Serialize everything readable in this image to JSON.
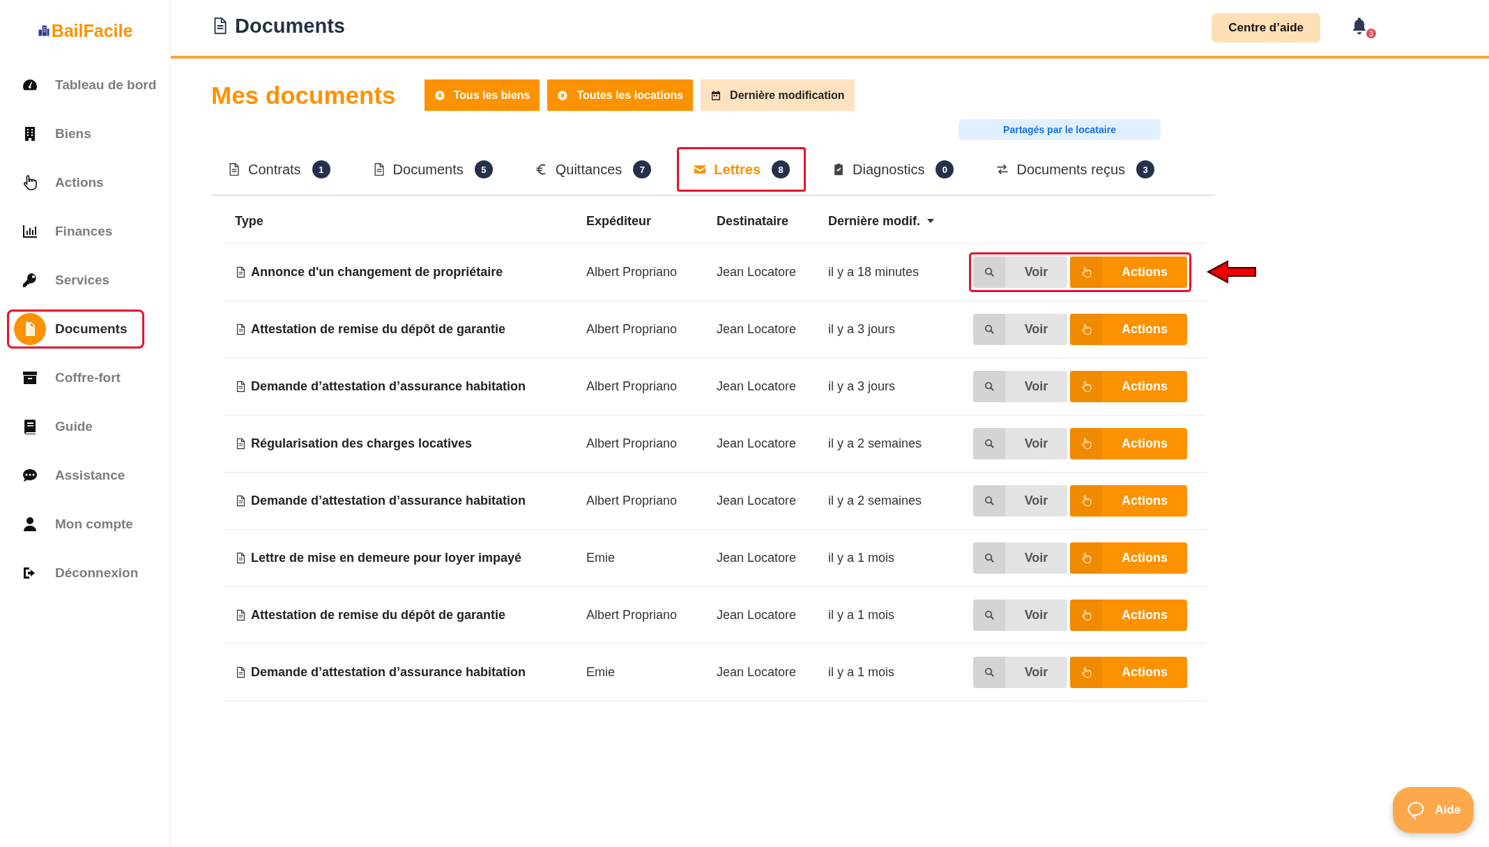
{
  "brand": {
    "name": "BailFacile"
  },
  "sidebar": {
    "items": [
      {
        "label": "Tableau de bord",
        "selected": false,
        "highlighted": false
      },
      {
        "label": "Biens",
        "selected": false,
        "highlighted": false
      },
      {
        "label": "Actions",
        "selected": false,
        "highlighted": false
      },
      {
        "label": "Finances",
        "selected": false,
        "highlighted": false
      },
      {
        "label": "Services",
        "selected": false,
        "highlighted": false
      },
      {
        "label": "Documents",
        "selected": true,
        "highlighted": true
      },
      {
        "label": "Coffre-fort",
        "selected": false,
        "highlighted": false
      },
      {
        "label": "Guide",
        "selected": false,
        "highlighted": false
      },
      {
        "label": "Assistance",
        "selected": false,
        "highlighted": false
      },
      {
        "label": "Mon compte",
        "selected": false,
        "highlighted": false
      },
      {
        "label": "Déconnexion",
        "selected": false,
        "highlighted": false
      }
    ]
  },
  "header": {
    "title": "Documents",
    "help_button": "Centre d’aide",
    "notification_count": "3"
  },
  "page_title": "Mes documents",
  "filters": [
    {
      "label": "Tous les biens",
      "kind": "clear"
    },
    {
      "label": "Toutes les locations",
      "kind": "clear"
    },
    {
      "label": "Dernière modification",
      "kind": "date"
    }
  ],
  "shared_label": "Partagés par le locataire",
  "tabs": [
    {
      "label": "Contrats",
      "count": "1",
      "kind": "file",
      "selected": false,
      "highlighted": false
    },
    {
      "label": "Documents",
      "count": "5",
      "kind": "file",
      "selected": false,
      "highlighted": false
    },
    {
      "label": "Quittances",
      "count": "7",
      "kind": "euro",
      "selected": false,
      "highlighted": false
    },
    {
      "label": "Lettres",
      "count": "8",
      "kind": "mail",
      "selected": true,
      "highlighted": true
    },
    {
      "label": "Diagnostics",
      "count": "0",
      "kind": "clipboard",
      "selected": false,
      "highlighted": false
    },
    {
      "label": "Documents reçus",
      "count": "3",
      "kind": "swap",
      "selected": false,
      "highlighted": false
    }
  ],
  "table": {
    "columns": [
      "Type",
      "Expéditeur",
      "Destinataire",
      "Dernière modif."
    ],
    "rows": [
      {
        "type": "Annonce d'un changement de propriétaire",
        "sender": "Albert Propriano",
        "recipient": "Jean Locatore",
        "modified": "il y a 18 minutes",
        "view": "Voir",
        "actions": "Actions",
        "highlighted": true
      },
      {
        "type": "Attestation de remise du dépôt de garantie",
        "sender": "Albert Propriano",
        "recipient": "Jean Locatore",
        "modified": "il y a 3 jours",
        "view": "Voir",
        "actions": "Actions",
        "highlighted": false
      },
      {
        "type": "Demande d’attestation d’assurance habitation",
        "sender": "Albert Propriano",
        "recipient": "Jean Locatore",
        "modified": "il y a 3 jours",
        "view": "Voir",
        "actions": "Actions",
        "highlighted": false
      },
      {
        "type": "Régularisation des charges locatives",
        "sender": "Albert Propriano",
        "recipient": "Jean Locatore",
        "modified": "il y a 2 semaines",
        "view": "Voir",
        "actions": "Actions",
        "highlighted": false
      },
      {
        "type": "Demande d’attestation d’assurance habitation",
        "sender": "Albert Propriano",
        "recipient": "Jean Locatore",
        "modified": "il y a 2 semaines",
        "view": "Voir",
        "actions": "Actions",
        "highlighted": false
      },
      {
        "type": "Lettre de mise en demeure pour loyer impayé",
        "sender": "Emie",
        "recipient": "Jean Locatore",
        "modified": "il y a 1 mois",
        "view": "Voir",
        "actions": "Actions",
        "highlighted": false
      },
      {
        "type": "Attestation de remise du dépôt de garantie",
        "sender": "Albert Propriano",
        "recipient": "Jean Locatore",
        "modified": "il y a 1 mois",
        "view": "Voir",
        "actions": "Actions",
        "highlighted": false
      },
      {
        "type": "Demande d’attestation d’assurance habitation",
        "sender": "Emie",
        "recipient": "Jean Locatore",
        "modified": "il y a 1 mois",
        "view": "Voir",
        "actions": "Actions",
        "highlighted": false
      }
    ]
  },
  "help_fab": "Aide"
}
